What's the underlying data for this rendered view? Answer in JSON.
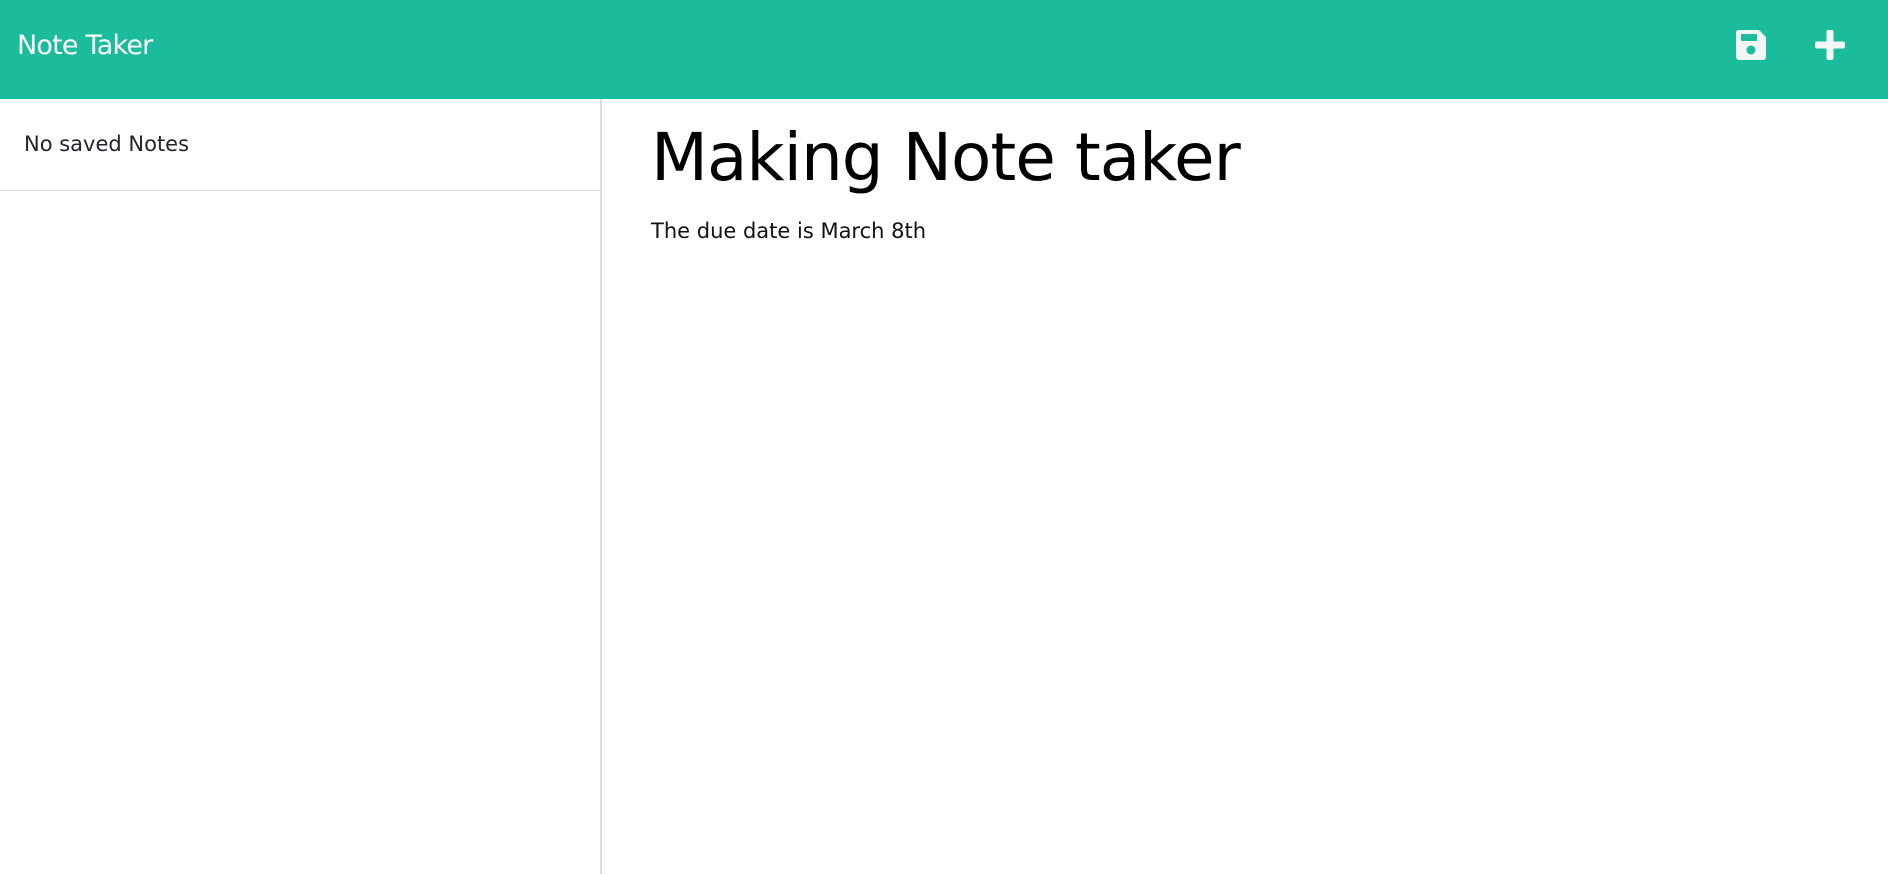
{
  "navbar": {
    "brand": "Note Taker",
    "background_color": "#1abc9c",
    "save_icon": "floppy-disk-icon",
    "new_icon": "plus-icon"
  },
  "sidebar": {
    "empty_message": "No saved Notes"
  },
  "note": {
    "title": "Making Note taker",
    "body": "The due date is March 8th"
  }
}
